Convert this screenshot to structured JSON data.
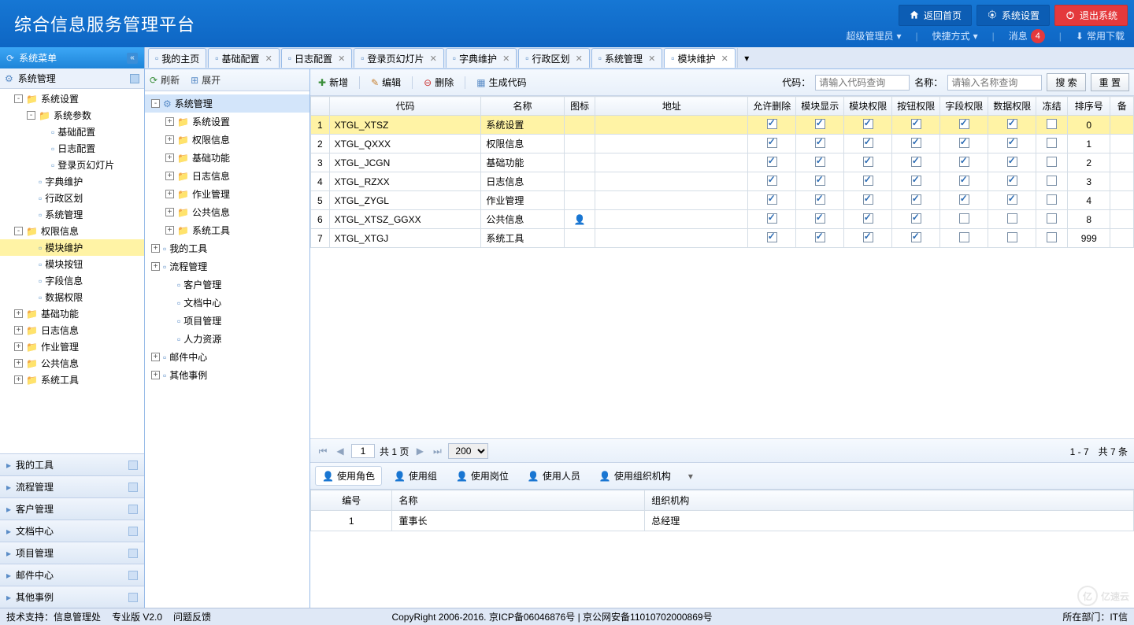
{
  "header": {
    "title": "综合信息服务管理平台",
    "btn_home": "返回首页",
    "btn_settings": "系统设置",
    "btn_exit": "退出系统",
    "admin": "超级管理员",
    "quick": "快捷方式",
    "msg_label": "消息",
    "msg_count": "4",
    "download": "常用下载"
  },
  "sidebar": {
    "panel_title": "系统菜单",
    "sys_mgmt": "系统管理",
    "tree": [
      {
        "lvl": 1,
        "exp": "-",
        "ico": "fld",
        "label": "系统设置"
      },
      {
        "lvl": 2,
        "exp": "-",
        "ico": "fld",
        "label": "系统参数"
      },
      {
        "lvl": 3,
        "exp": "",
        "ico": "doc",
        "label": "基础配置"
      },
      {
        "lvl": 3,
        "exp": "",
        "ico": "doc",
        "label": "日志配置"
      },
      {
        "lvl": 3,
        "exp": "",
        "ico": "doc",
        "label": "登录页幻灯片"
      },
      {
        "lvl": 2,
        "exp": "",
        "ico": "doc",
        "label": "字典维护"
      },
      {
        "lvl": 2,
        "exp": "",
        "ico": "doc",
        "label": "行政区划"
      },
      {
        "lvl": 2,
        "exp": "",
        "ico": "doc",
        "label": "系统管理"
      },
      {
        "lvl": 1,
        "exp": "-",
        "ico": "fld",
        "label": "权限信息"
      },
      {
        "lvl": 2,
        "exp": "",
        "ico": "doc",
        "label": "模块维护",
        "selected": true
      },
      {
        "lvl": 2,
        "exp": "",
        "ico": "doc",
        "label": "模块按钮"
      },
      {
        "lvl": 2,
        "exp": "",
        "ico": "doc",
        "label": "字段信息"
      },
      {
        "lvl": 2,
        "exp": "",
        "ico": "doc",
        "label": "数据权限"
      },
      {
        "lvl": 1,
        "exp": "+",
        "ico": "fld",
        "label": "基础功能"
      },
      {
        "lvl": 1,
        "exp": "+",
        "ico": "fld",
        "label": "日志信息"
      },
      {
        "lvl": 1,
        "exp": "+",
        "ico": "fld",
        "label": "作业管理"
      },
      {
        "lvl": 1,
        "exp": "+",
        "ico": "fld",
        "label": "公共信息"
      },
      {
        "lvl": 1,
        "exp": "+",
        "ico": "fld",
        "label": "系统工具"
      }
    ],
    "bottom": [
      "我的工具",
      "流程管理",
      "客户管理",
      "文档中心",
      "项目管理",
      "邮件中心",
      "其他事例"
    ]
  },
  "tabs": [
    {
      "label": "我的主页",
      "closable": false
    },
    {
      "label": "基础配置",
      "closable": true
    },
    {
      "label": "日志配置",
      "closable": true
    },
    {
      "label": "登录页幻灯片",
      "closable": true
    },
    {
      "label": "字典维护",
      "closable": true
    },
    {
      "label": "行政区划",
      "closable": true
    },
    {
      "label": "系统管理",
      "closable": true
    },
    {
      "label": "模块维护",
      "closable": true,
      "active": true
    }
  ],
  "mid": {
    "refresh": "刷新",
    "expand": "展开",
    "tree": [
      {
        "lvl": 0,
        "exp": "-",
        "ico": "gear",
        "label": "系统管理",
        "sel": true
      },
      {
        "lvl": 1,
        "exp": "+",
        "ico": "fld",
        "label": "系统设置"
      },
      {
        "lvl": 1,
        "exp": "+",
        "ico": "fld",
        "label": "权限信息"
      },
      {
        "lvl": 1,
        "exp": "+",
        "ico": "fld",
        "label": "基础功能"
      },
      {
        "lvl": 1,
        "exp": "+",
        "ico": "fld",
        "label": "日志信息"
      },
      {
        "lvl": 1,
        "exp": "+",
        "ico": "fld",
        "label": "作业管理"
      },
      {
        "lvl": 1,
        "exp": "+",
        "ico": "fld",
        "label": "公共信息"
      },
      {
        "lvl": 1,
        "exp": "+",
        "ico": "fld",
        "label": "系统工具"
      },
      {
        "lvl": 0,
        "exp": "+",
        "ico": "tool",
        "label": "我的工具"
      },
      {
        "lvl": 0,
        "exp": "+",
        "ico": "flow",
        "label": "流程管理"
      },
      {
        "lvl": 1,
        "exp": "",
        "ico": "user",
        "label": "客户管理"
      },
      {
        "lvl": 1,
        "exp": "",
        "ico": "doc",
        "label": "文档中心"
      },
      {
        "lvl": 1,
        "exp": "",
        "ico": "proj",
        "label": "项目管理"
      },
      {
        "lvl": 1,
        "exp": "",
        "ico": "hr",
        "label": "人力资源"
      },
      {
        "lvl": 0,
        "exp": "+",
        "ico": "mail",
        "label": "邮件中心"
      },
      {
        "lvl": 0,
        "exp": "+",
        "ico": "doc",
        "label": "其他事例"
      }
    ]
  },
  "toolbar": {
    "add": "新增",
    "edit": "编辑",
    "del": "删除",
    "gen": "生成代码",
    "code_lbl": "代码：",
    "code_ph": "请输入代码查询",
    "name_lbl": "名称：",
    "name_ph": "请输入名称查询",
    "search": "搜 索",
    "reset": "重 置"
  },
  "grid": {
    "cols": [
      " ",
      "代码",
      "名称",
      "图标",
      "地址",
      "允许删除",
      "模块显示",
      "模块权限",
      "按钮权限",
      "字段权限",
      "数据权限",
      "冻结",
      "排序号",
      "备"
    ],
    "rows": [
      {
        "n": 1,
        "code": "XTGL_XTSZ",
        "name": "系统设置",
        "icon": "",
        "addr": "",
        "c": [
          1,
          1,
          1,
          1,
          1,
          1,
          0
        ],
        "sort": "0",
        "sel": true
      },
      {
        "n": 2,
        "code": "XTGL_QXXX",
        "name": "权限信息",
        "icon": "",
        "addr": "",
        "c": [
          1,
          1,
          1,
          1,
          1,
          1,
          0
        ],
        "sort": "1"
      },
      {
        "n": 3,
        "code": "XTGL_JCGN",
        "name": "基础功能",
        "icon": "",
        "addr": "",
        "c": [
          1,
          1,
          1,
          1,
          1,
          1,
          0
        ],
        "sort": "2"
      },
      {
        "n": 4,
        "code": "XTGL_RZXX",
        "name": "日志信息",
        "icon": "",
        "addr": "",
        "c": [
          1,
          1,
          1,
          1,
          1,
          1,
          0
        ],
        "sort": "3"
      },
      {
        "n": 5,
        "code": "XTGL_ZYGL",
        "name": "作业管理",
        "icon": "",
        "addr": "",
        "c": [
          1,
          1,
          1,
          1,
          1,
          1,
          0
        ],
        "sort": "4"
      },
      {
        "n": 6,
        "code": "XTGL_XTSZ_GGXX",
        "name": "公共信息",
        "icon": "ico",
        "addr": "",
        "c": [
          1,
          1,
          1,
          1,
          0,
          0,
          0
        ],
        "sort": "8"
      },
      {
        "n": 7,
        "code": "XTGL_XTGJ",
        "name": "系统工具",
        "icon": "",
        "addr": "",
        "c": [
          1,
          1,
          1,
          1,
          0,
          0,
          0
        ],
        "sort": "999"
      }
    ]
  },
  "pager": {
    "page": "1",
    "of_pre": "共",
    "of_suf": "页",
    "total_pages": "1",
    "page_size": "200",
    "status": "1 - 7　共 7 条"
  },
  "subtabs": [
    {
      "label": "使用角色",
      "active": true
    },
    {
      "label": "使用组"
    },
    {
      "label": "使用岗位"
    },
    {
      "label": "使用人员"
    },
    {
      "label": "使用组织机构"
    }
  ],
  "subgrid": {
    "cols": [
      "编号",
      "名称",
      "组织机构"
    ],
    "rows": [
      {
        "no": "1",
        "name": "董事长",
        "org": "总经理"
      }
    ]
  },
  "footer": {
    "tech": "技术支持：信息管理处",
    "ver": "专业版 V2.0",
    "feedback": "问题反馈",
    "center": "CopyRight 2006-2016. 京ICP备06046876号 | 京公网安备11010702000869号",
    "dept": "所在部门：IT信"
  },
  "watermark": "亿速云"
}
